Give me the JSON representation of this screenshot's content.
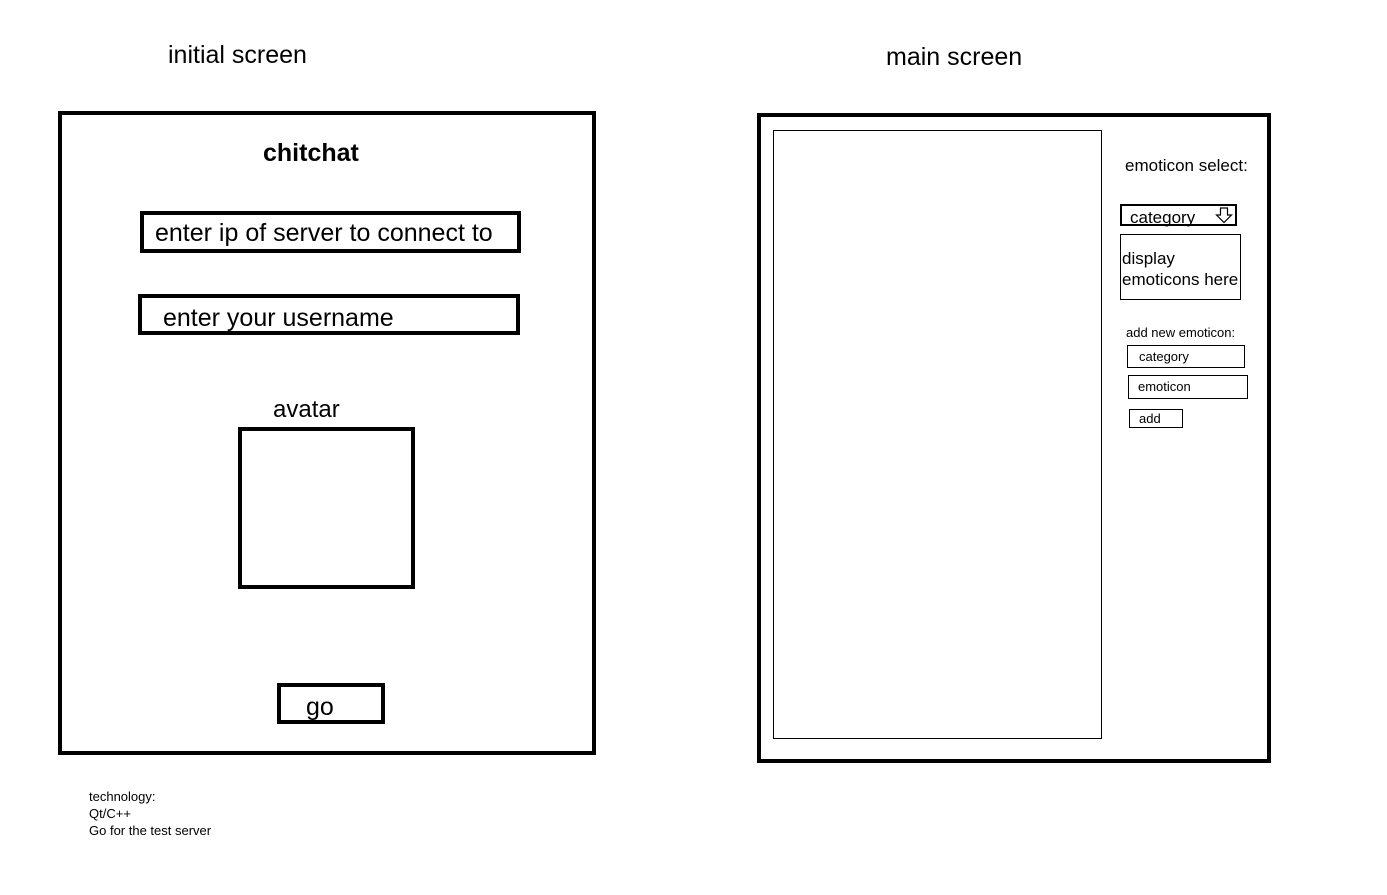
{
  "initial_screen": {
    "heading": "initial screen",
    "app_title": "chitchat",
    "server_ip_placeholder": "enter ip of server to connect to",
    "username_placeholder": "enter your username",
    "avatar_label": "avatar",
    "go_label": "go"
  },
  "main_screen": {
    "heading": "main screen",
    "emoticon_select_label": "emoticon select:",
    "category_dropdown_value": "category",
    "emoticon_display_text": "display emoticons here",
    "add_new_label": "add new emoticon:",
    "category_field": "category",
    "emoticon_field": "emoticon",
    "add_label": "add"
  },
  "notes": {
    "line1": "technology:",
    "line2": "Qt/C++",
    "line3": "Go for the test server"
  }
}
